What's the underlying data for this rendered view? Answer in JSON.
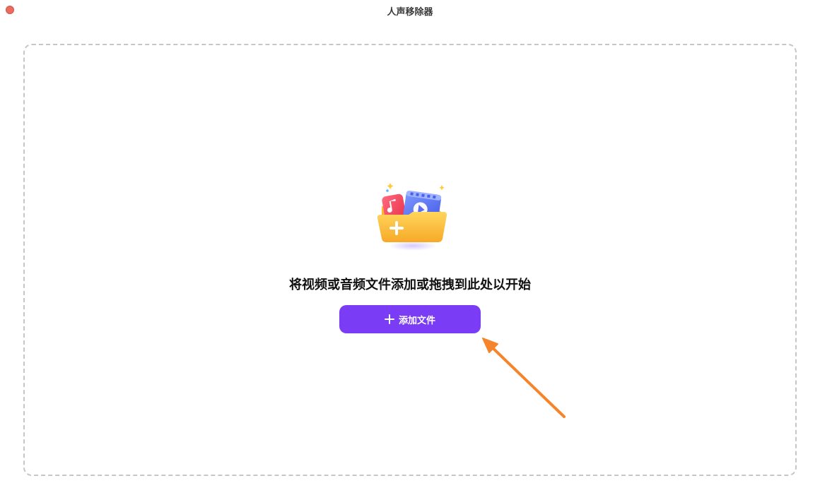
{
  "window": {
    "title": "人声移除器"
  },
  "dropzone": {
    "prompt": "将视频或音频文件添加或拖拽到此处以开始",
    "add_button_label": "添加文件"
  },
  "icons": {
    "close": "close-dot-icon",
    "illustration": "media-folder-icon",
    "plus": "plus-icon",
    "arrow": "annotation-arrow-icon"
  },
  "colors": {
    "accent": "#7a3cf5",
    "annotation": "#f5842a",
    "dropzone_border": "#c6c6c6"
  }
}
